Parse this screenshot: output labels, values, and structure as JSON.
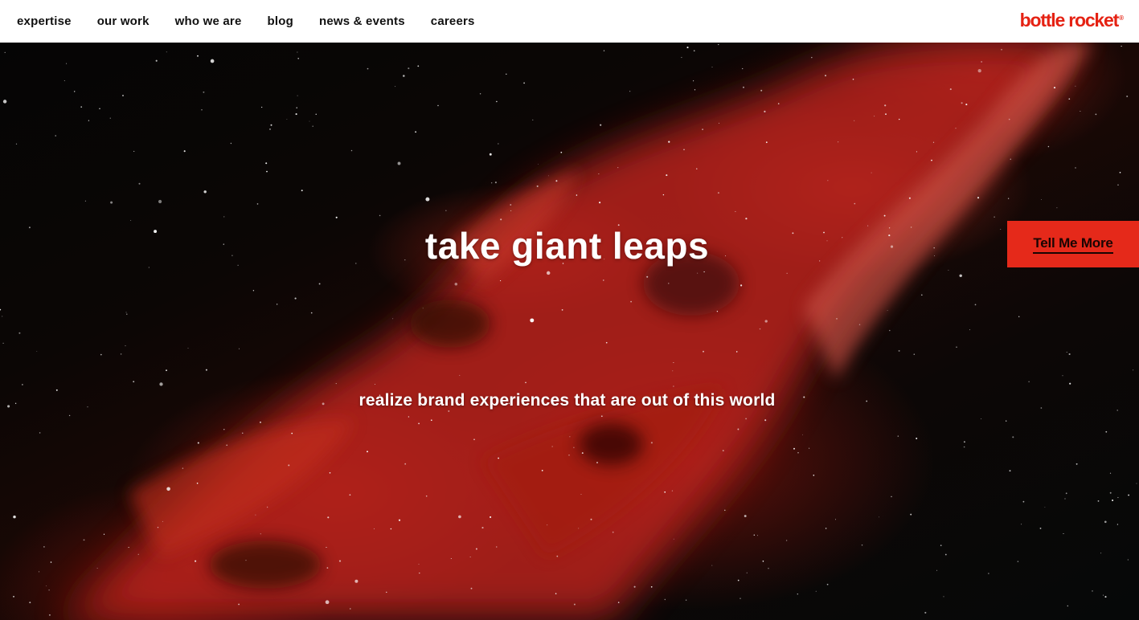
{
  "nav": {
    "items": [
      {
        "label": "expertise"
      },
      {
        "label": "our work"
      },
      {
        "label": "who we are"
      },
      {
        "label": "blog"
      },
      {
        "label": "news & events"
      },
      {
        "label": "careers"
      }
    ]
  },
  "logo": {
    "text": "bottle rocket",
    "mark": "®"
  },
  "hero": {
    "headline": "take giant leaps",
    "subline": "realize brand experiences that are out of this world",
    "cta_label": "Tell Me More",
    "background": "red-nebula-starfield-image"
  },
  "colors": {
    "brand_red": "#e52213",
    "cta_red": "#e5291a",
    "header_bg": "#ffffff",
    "nav_text": "#111111"
  }
}
